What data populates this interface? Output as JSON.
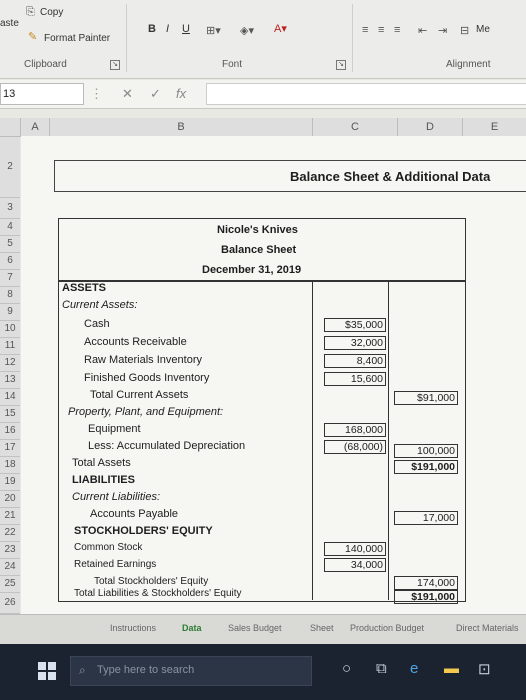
{
  "ribbon": {
    "paste_label": "aste",
    "copy_label": "Copy",
    "format_painter_label": "Format Painter",
    "font_style_buttons": [
      "B",
      "I",
      "U"
    ],
    "merge_label": "Me",
    "groups": {
      "clipboard": "Clipboard",
      "font": "Font",
      "alignment": "Alignment"
    }
  },
  "formula_bar": {
    "name_box": "13",
    "cancel_symbol": "✕",
    "enter_symbol": "✓",
    "fx_symbol": "fx",
    "value": ""
  },
  "columns": [
    "A",
    "B",
    "C",
    "D",
    "E"
  ],
  "rows": [
    "2",
    "3",
    "4",
    "5",
    "6",
    "7",
    "8",
    "9",
    "10",
    "11",
    "12",
    "13",
    "14",
    "15",
    "16",
    "17",
    "18",
    "19",
    "20",
    "21",
    "22",
    "23",
    "24",
    "25",
    "26"
  ],
  "sheet": {
    "banner": "Balance Sheet & Additional Data",
    "company": "Nicole's Knives",
    "statement": "Balance Sheet",
    "date": "December 31, 2019",
    "lines": {
      "assets": "ASSETS",
      "current_assets": "Current Assets:",
      "cash": "Cash",
      "ar": "Accounts Receivable",
      "raw_materials": "Raw Materials Inventory",
      "finished_goods": "Finished Goods Inventory",
      "total_current": "Total Current Assets",
      "ppe": "Property, Plant, and Equipment:",
      "equipment": "Equipment",
      "accum_dep": "Less: Accumulated Depreciation",
      "total_assets": "Total Assets",
      "liabilities": "LIABILITIES",
      "current_liabilities": "Current Liabilities:",
      "ap": "Accounts Payable",
      "equity": "STOCKHOLDERS' EQUITY",
      "common_stock": "Common Stock",
      "retained_earnings": "Retained Earnings",
      "total_equity": "Total Stockholders' Equity",
      "total_liab_equity": "Total Liabilities & Stockholders' Equity"
    },
    "values": {
      "cash": "$35,000",
      "ar": "32,000",
      "raw_materials": "8,400",
      "finished_goods": "15,600",
      "total_current": "$91,000",
      "equipment": "168,000",
      "accum_dep": "(68,000)",
      "net_ppe": "100,000",
      "total_assets": "$191,000",
      "ap": "17,000",
      "common_stock": "140,000",
      "retained_earnings": "34,000",
      "total_equity": "174,000",
      "total_liab_equity": "$191,000"
    }
  },
  "sheet_tabs": [
    "Instructions",
    "Data",
    "Sales Budget",
    "Sheet",
    "Production Budget",
    "Direct Materials"
  ],
  "taskbar": {
    "search_placeholder": "Type here to search"
  }
}
